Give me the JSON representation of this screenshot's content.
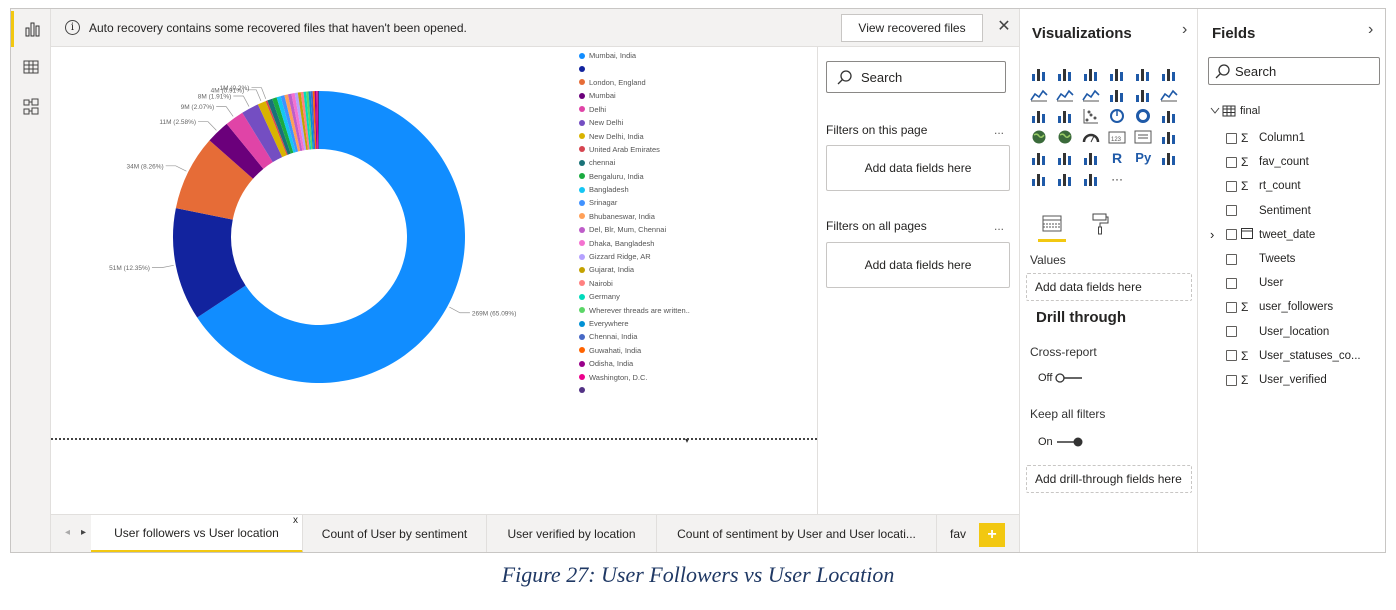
{
  "notice": {
    "message": "Auto recovery contains some recovered files that haven't been opened.",
    "button": "View recovered files",
    "info_icon": "i",
    "close_icon": "✕"
  },
  "chart_data": {
    "type": "pie",
    "variant": "donut",
    "slices": [
      {
        "label": "Mumbai, India",
        "value": 269,
        "display": "269M (65.09%)",
        "percent": 65.09,
        "color": "#118dff"
      },
      {
        "label": "",
        "value": 51,
        "display": "51M (12.35%)",
        "percent": 12.35,
        "color": "#12239e"
      },
      {
        "label": "London, England",
        "value": 34,
        "display": "34M (8.26%)",
        "percent": 8.26,
        "color": "#e66c37"
      },
      {
        "label": "Mumbai",
        "value": 11,
        "display": "11M (2.58%)",
        "percent": 2.58,
        "color": "#6b007b"
      },
      {
        "label": "Delhi",
        "value": 9,
        "display": "9M (2.07%)",
        "percent": 2.07,
        "color": "#e044a7"
      },
      {
        "label": "New Delhi",
        "value": 8,
        "display": "8M (1.91%)",
        "percent": 1.91,
        "color": "#744ec2"
      },
      {
        "label": "New Delhi, India",
        "value": 4,
        "display": "4M (0.91%)",
        "percent": 0.91,
        "color": "#d9b300"
      },
      {
        "label": "United Arab Emirates",
        "value": 1,
        "display": "1M (0.2%)",
        "percent": 0.2,
        "color": "#d64550"
      },
      {
        "label": "chennai",
        "value": 1,
        "display": "",
        "percent": 0.55,
        "color": "#197278"
      },
      {
        "label": "Bengaluru, India",
        "value": 1,
        "display": "",
        "percent": 0.5,
        "color": "#1aab40"
      },
      {
        "label": "Bangladesh",
        "value": 1,
        "display": "",
        "percent": 0.45,
        "color": "#15c6f4"
      },
      {
        "label": "Srinagar",
        "value": 1,
        "display": "",
        "percent": 0.42,
        "color": "#4092ff"
      },
      {
        "label": "Bhubaneswar, India",
        "value": 1,
        "display": "",
        "percent": 0.4,
        "color": "#ffa058"
      },
      {
        "label": "Del, Blr, Mum, Chennai",
        "value": 1,
        "display": "",
        "percent": 0.38,
        "color": "#be5dc9"
      },
      {
        "label": "Dhaka, Bangladesh",
        "value": 1,
        "display": "",
        "percent": 0.36,
        "color": "#f472d0"
      },
      {
        "label": "Gizzard Ridge, AR",
        "value": 1,
        "display": "",
        "percent": 0.34,
        "color": "#b5a1ff"
      },
      {
        "label": "Gujarat, India",
        "value": 1,
        "display": "",
        "percent": 0.32,
        "color": "#c4a200"
      },
      {
        "label": "Nairobi",
        "value": 1,
        "display": "",
        "percent": 0.3,
        "color": "#ff8080"
      },
      {
        "label": "Germany",
        "value": 1,
        "display": "",
        "percent": 0.28,
        "color": "#00dbbc"
      },
      {
        "label": "Wherever threads are written..",
        "value": 1,
        "display": "",
        "percent": 0.26,
        "color": "#5bd667"
      },
      {
        "label": "Everywhere",
        "value": 1,
        "display": "",
        "percent": 0.24,
        "color": "#0091d5"
      },
      {
        "label": "Chennai, India",
        "value": 1,
        "display": "",
        "percent": 0.22,
        "color": "#4668c5"
      },
      {
        "label": "Guwahati, India",
        "value": 1,
        "display": "",
        "percent": 0.2,
        "color": "#ff6300"
      },
      {
        "label": "Odisha, India",
        "value": 1,
        "display": "",
        "percent": 0.18,
        "color": "#99008a"
      },
      {
        "label": "Washington, D.C.",
        "value": 1,
        "display": "",
        "percent": 0.16,
        "color": "#ec008c"
      },
      {
        "label": "",
        "value": 1,
        "display": "",
        "percent": 0.14,
        "color": "#533285"
      }
    ],
    "legend_placement": "right"
  },
  "filters": {
    "search_placeholder": "Search",
    "on_page": "Filters on this page",
    "on_all": "Filters on all pages",
    "add_fields": "Add data fields here",
    "more": "..."
  },
  "tabs": {
    "items": [
      "User followers vs User location",
      "Count of User by sentiment",
      "User verified by location",
      "Count of sentiment by User and User locati...",
      "fav"
    ],
    "close": "x",
    "add": "+",
    "prev": "◂",
    "next": "▸"
  },
  "viz": {
    "title": "Visualizations",
    "chevron": "›",
    "values_label": "Values",
    "add_values": "Add data fields here",
    "drill_title": "Drill through",
    "cross_report": "Cross-report",
    "off": "Off",
    "keep_filters": "Keep all filters",
    "on": "On",
    "add_drill": "Add drill-through fields here",
    "glyph_r": "R",
    "glyph_py": "Py",
    "ellipsis": "···",
    "glyph_123": "123"
  },
  "fields": {
    "title": "Fields",
    "chevron": "›",
    "search_placeholder": "Search",
    "table": "final",
    "items": [
      {
        "name": "Column1",
        "sigma": true
      },
      {
        "name": "fav_count",
        "sigma": true
      },
      {
        "name": "rt_count",
        "sigma": true
      },
      {
        "name": "Sentiment",
        "sigma": false
      },
      {
        "name": "tweet_date",
        "sigma": false,
        "calendar": true
      },
      {
        "name": "Tweets",
        "sigma": false
      },
      {
        "name": "User",
        "sigma": false
      },
      {
        "name": "user_followers",
        "sigma": true
      },
      {
        "name": "User_location",
        "sigma": false
      },
      {
        "name": "User_statuses_co...",
        "sigma": true
      },
      {
        "name": "User_verified",
        "sigma": true
      }
    ]
  },
  "caption": "Figure 27: User Followers vs User Location",
  "colors": {
    "accent": "#f2c811",
    "primary_blue": "#118dff"
  }
}
